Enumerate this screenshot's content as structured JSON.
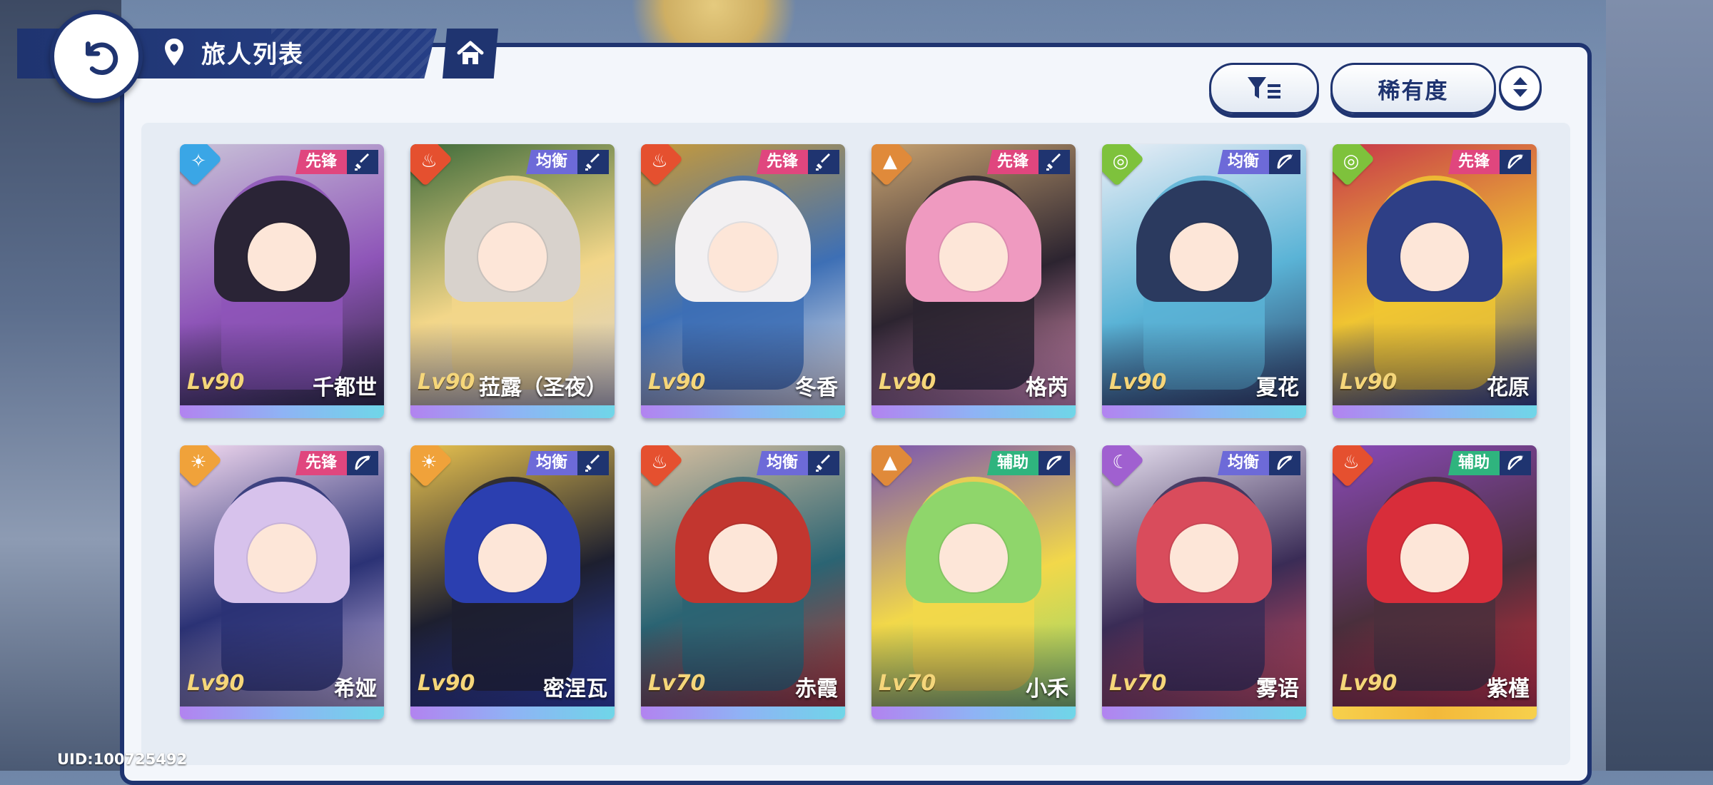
{
  "header": {
    "title": "旅人列表",
    "back_icon": "back-arrow-icon",
    "location_icon": "location-pin-icon",
    "home_icon": "home-icon"
  },
  "toolbar": {
    "filter_icon": "filter-icon",
    "sort_label": "稀有度",
    "sort_toggle_icon": "sort-order-icon"
  },
  "colors": {
    "navy": "#1f3470",
    "tag_vanguard": "#e0467e",
    "tag_balance": "#6d6ad8",
    "tag_support": "#2fb47e",
    "rarity_gradient_purple": "#b283f0",
    "rarity_gradient_gold": "#f7d04c"
  },
  "characters": [
    {
      "name": "千都世",
      "level": "Lv90",
      "role": "先锋",
      "element": "water",
      "weapon": "sword",
      "art": [
        "#2a2436",
        "#8e55b8",
        "#c9c2d8"
      ],
      "rarity": "purple"
    },
    {
      "name": "菈露（圣夜）",
      "level": "Lv90",
      "role": "均衡",
      "element": "fire",
      "weapon": "sword",
      "art": [
        "#d8d2cc",
        "#f2d689",
        "#3f6b3a"
      ],
      "rarity": "purple"
    },
    {
      "name": "冬香",
      "level": "Lv90",
      "role": "先锋",
      "element": "fire",
      "weapon": "sword",
      "art": [
        "#f2f0f2",
        "#3d6fb5",
        "#c79a3a"
      ],
      "rarity": "purple"
    },
    {
      "name": "格芮",
      "level": "Lv90",
      "role": "先锋",
      "element": "earth",
      "weapon": "sword",
      "art": [
        "#ef9ac0",
        "#2c2430",
        "#c7a270"
      ],
      "rarity": "purple"
    },
    {
      "name": "夏花",
      "level": "Lv90",
      "role": "均衡",
      "element": "wind",
      "weapon": "bow",
      "art": [
        "#2b3a5f",
        "#5ab3d6",
        "#e9eef6"
      ],
      "rarity": "purple"
    },
    {
      "name": "花原",
      "level": "Lv90",
      "role": "先锋",
      "element": "wind",
      "weapon": "bow",
      "art": [
        "#2e3f86",
        "#f0c532",
        "#c7384a"
      ],
      "rarity": "purple"
    },
    {
      "name": "希娅",
      "level": "Lv90",
      "role": "先锋",
      "element": "light",
      "weapon": "bow",
      "art": [
        "#d7c2ec",
        "#2b3275",
        "#f2d9f0"
      ],
      "rarity": "purple"
    },
    {
      "name": "密涅瓦",
      "level": "Lv90",
      "role": "均衡",
      "element": "light",
      "weapon": "sword",
      "art": [
        "#2b3fb0",
        "#1d1f2f",
        "#e8c24f"
      ],
      "rarity": "purple"
    },
    {
      "name": "赤霞",
      "level": "Lv70",
      "role": "均衡",
      "element": "fire",
      "weapon": "sword",
      "art": [
        "#c2362f",
        "#2b6473",
        "#d9c0a0"
      ],
      "rarity": "purple"
    },
    {
      "name": "小禾",
      "level": "Lv70",
      "role": "辅助",
      "element": "earth",
      "weapon": "bow",
      "art": [
        "#8fd66b",
        "#f2d84a",
        "#7a55b0"
      ],
      "rarity": "purple"
    },
    {
      "name": "雾语",
      "level": "Lv70",
      "role": "均衡",
      "element": "dark",
      "weapon": "bow",
      "art": [
        "#d94c5c",
        "#3a2c56",
        "#e9e2f2"
      ],
      "rarity": "purple"
    },
    {
      "name": "紫槿",
      "level": "Lv90",
      "role": "辅助",
      "element": "fire",
      "weapon": "bow",
      "art": [
        "#d82d3a",
        "#4a2f3c",
        "#8a4ab8"
      ],
      "rarity": "gold"
    }
  ],
  "footer": {
    "uid": "UID:100725492"
  }
}
